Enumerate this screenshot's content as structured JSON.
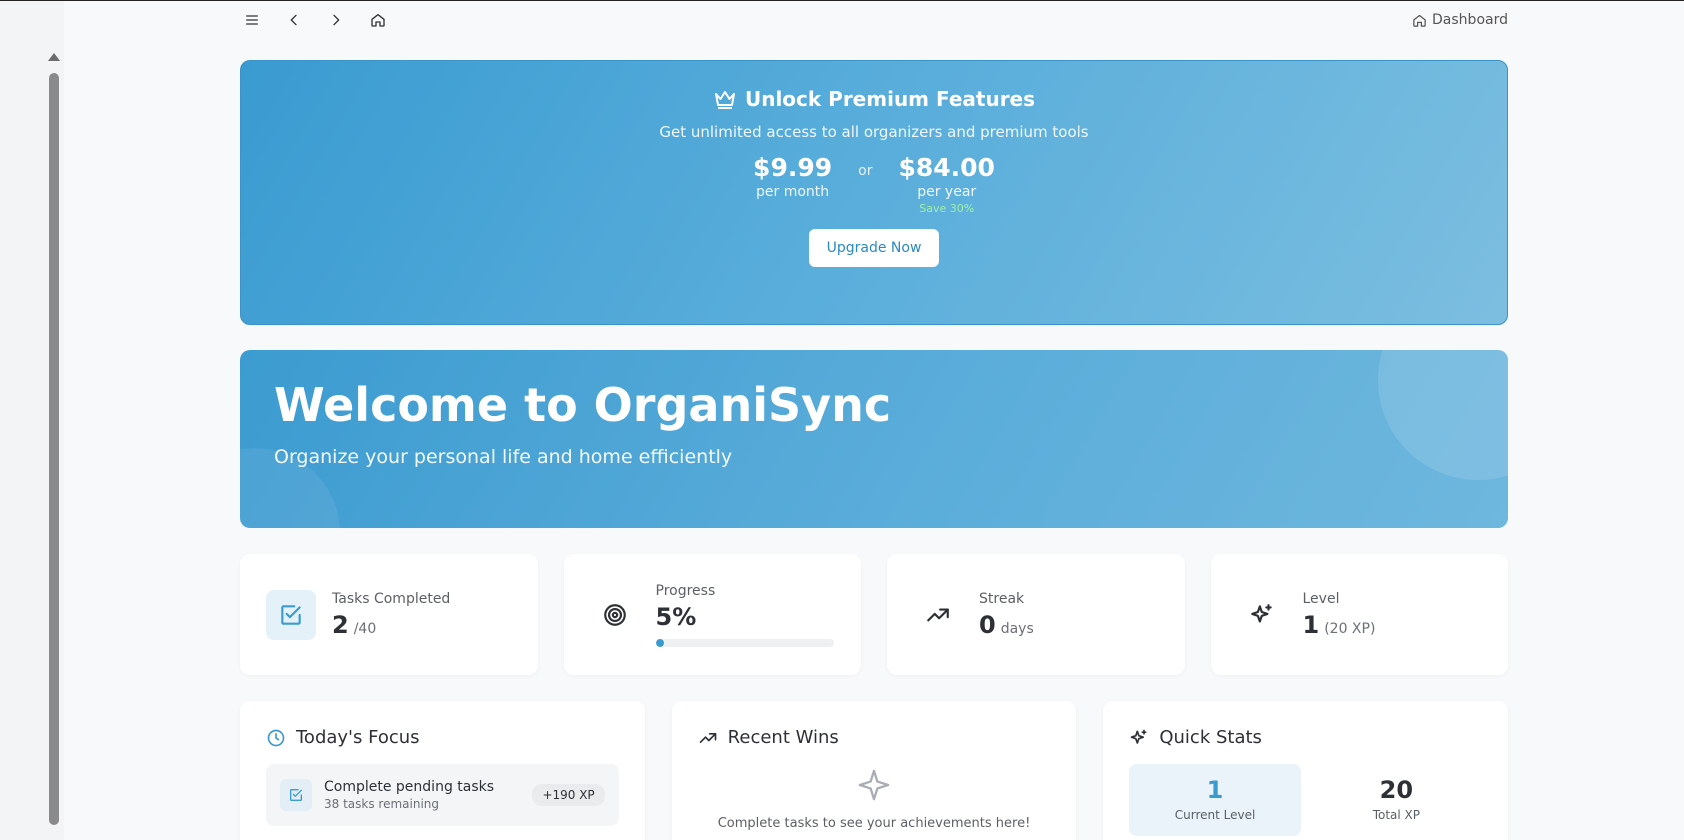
{
  "nav": {
    "dashboard_label": "Dashboard"
  },
  "premium": {
    "title": "Unlock Premium Features",
    "subtitle": "Get unlimited access to all organizers and premium tools",
    "monthly_price": "$9.99",
    "monthly_period": "per month",
    "or_label": "or",
    "yearly_price": "$84.00",
    "yearly_period": "per year",
    "yearly_save": "Save 30%",
    "button_label": "Upgrade Now"
  },
  "welcome": {
    "title": "Welcome to OrganiSync",
    "subtitle": "Organize your personal life and home efficiently"
  },
  "stats": {
    "tasks": {
      "label": "Tasks Completed",
      "value": "2",
      "suffix": "/40"
    },
    "progress": {
      "label": "Progress",
      "value": "5%",
      "fraction": 0.05
    },
    "streak": {
      "label": "Streak",
      "value": "0",
      "suffix": "days"
    },
    "level": {
      "label": "Level",
      "value": "1",
      "suffix": "(20 XP)"
    }
  },
  "focus": {
    "title": "Today's Focus",
    "item_title": "Complete pending tasks",
    "item_sub": "38 tasks remaining",
    "item_badge": "+190 XP"
  },
  "wins": {
    "title": "Recent Wins",
    "empty_text": "Complete tasks to see your achievements here!"
  },
  "quick_stats": {
    "title": "Quick Stats",
    "current_level_value": "1",
    "current_level_label": "Current Level",
    "total_xp_value": "20",
    "total_xp_label": "Total XP"
  },
  "colors": {
    "accent": "#3a9bd1",
    "save_green": "#9ff0a8"
  }
}
